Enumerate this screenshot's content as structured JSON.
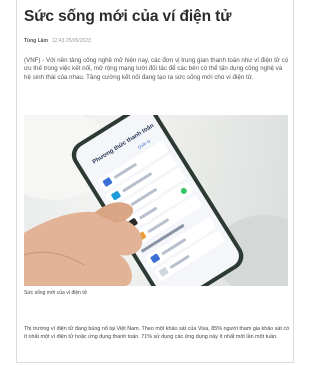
{
  "article": {
    "title": "Sức sống mới của ví điện tử",
    "author": "Tùng Lâm",
    "timestamp": "12:43 25/05/2023",
    "lead": "(VNF) - Với nền tảng công nghệ mở hiện nay, các đơn vị trung gian thanh toán như ví điện tử có ưu thế trong việc kết nối, mở rộng mạng lưới đối tác để các bên có thể tận dụng công nghệ và hệ sinh thái của nhau. Tăng cường kết nối đang tạo ra sức sống mới cho ví điện tử.",
    "image_caption": "Sức sống mới của ví điện tử",
    "body": "Thị trường ví điện tử đang bùng nổ tại Việt Nam. Theo một khảo sát của Visa, 85% người tham gia khảo sát có ít nhất một ví điện tử hoặc ứng dụng thanh toán. 71% sử dụng các ứng dụng này ít nhất một lần một tuần."
  },
  "phone_screen": {
    "header": "Phương thức thanh toán",
    "link": "Quản lý"
  }
}
